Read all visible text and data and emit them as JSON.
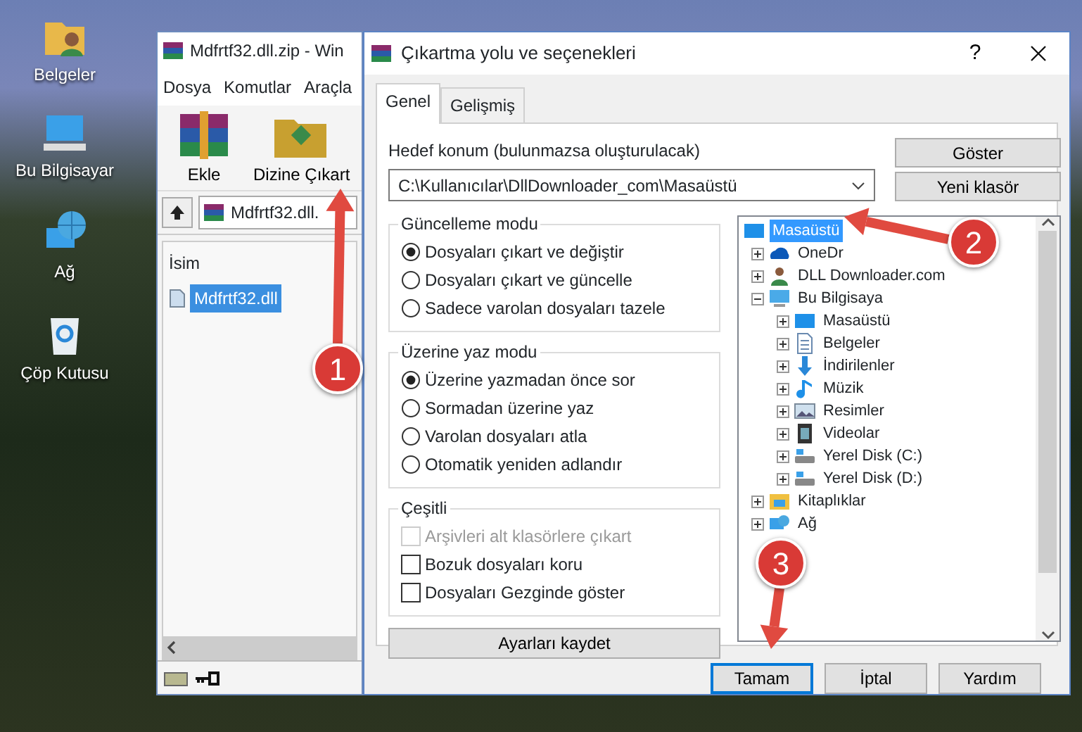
{
  "desktop_icons": [
    {
      "label": "Belgeler",
      "kind": "documents-folder"
    },
    {
      "label": "Bu Bilgisayar",
      "kind": "computer"
    },
    {
      "label": "Ağ",
      "kind": "network"
    },
    {
      "label": "Çöp Kutusu",
      "kind": "recycle-bin"
    }
  ],
  "winrar": {
    "title": "Mdfrtf32.dll.zip - Win",
    "menu": [
      "Dosya",
      "Komutlar",
      "Araçla"
    ],
    "toolbar": [
      {
        "label": "Ekle",
        "kind": "add"
      },
      {
        "label": "Dizine Çıkart",
        "kind": "extract"
      }
    ],
    "path": "Mdfrtf32.dll.",
    "column": "İsim",
    "files": [
      {
        "name": "Mdfrtf32.dll",
        "selected": true
      }
    ]
  },
  "dialog": {
    "title": "Çıkartma yolu ve seçenekleri",
    "help": "?",
    "tabs": [
      {
        "label": "Genel",
        "selected": true
      },
      {
        "label": "Gelişmiş",
        "selected": false
      }
    ],
    "destination_label": "Hedef konum (bulunmazsa oluşturulacak)",
    "destination": "C:\\Kullanıcılar\\DllDownloader_com\\Masaüstü",
    "side_buttons": [
      "Göster",
      "Yeni klasör"
    ],
    "update_mode": {
      "title": "Güncelleme modu",
      "options": [
        {
          "label": "Dosyaları çıkart ve değiştir",
          "selected": true
        },
        {
          "label": "Dosyaları çıkart ve güncelle",
          "selected": false
        },
        {
          "label": "Sadece varolan dosyaları tazele",
          "selected": false
        }
      ]
    },
    "overwrite_mode": {
      "title": "Üzerine yaz modu",
      "options": [
        {
          "label": "Üzerine yazmadan önce sor",
          "selected": true
        },
        {
          "label": "Sormadan üzerine yaz",
          "selected": false
        },
        {
          "label": "Varolan dosyaları atla",
          "selected": false
        },
        {
          "label": "Otomatik yeniden adlandır",
          "selected": false
        }
      ]
    },
    "misc": {
      "title": "Çeşitli",
      "options": [
        {
          "label": "Arşivleri alt klasörlere çıkart",
          "checked": false,
          "disabled": true
        },
        {
          "label": "Bozuk dosyaları koru",
          "checked": false,
          "disabled": false
        },
        {
          "label": "Dosyaları Gezginde göster",
          "checked": false,
          "disabled": false
        }
      ]
    },
    "save_button": "Ayarları kaydet",
    "tree": [
      {
        "label": "Masaüstü",
        "kind": "desktop",
        "selected": true,
        "children": [
          {
            "label": "OneDr",
            "kind": "cloud",
            "selected": false,
            "expanded": false
          },
          {
            "label": "DLL Downloader.com",
            "kind": "user",
            "selected": false,
            "expanded": false
          },
          {
            "label": "Bu Bilgisaya",
            "kind": "computer",
            "selected": false,
            "expanded": true,
            "children": [
              {
                "label": "Masaüstü",
                "kind": "desktop",
                "selected": false,
                "expanded": false
              },
              {
                "label": "Belgeler",
                "kind": "document",
                "selected": false,
                "expanded": false
              },
              {
                "label": "İndirilenler",
                "kind": "download",
                "selected": false,
                "expanded": false
              },
              {
                "label": "Müzik",
                "kind": "music",
                "selected": false,
                "expanded": false
              },
              {
                "label": "Resimler",
                "kind": "picture",
                "selected": false,
                "expanded": false
              },
              {
                "label": "Videolar",
                "kind": "video",
                "selected": false,
                "expanded": false
              },
              {
                "label": "Yerel Disk (C:)",
                "kind": "drive",
                "selected": false,
                "expanded": false
              },
              {
                "label": "Yerel Disk (D:)",
                "kind": "drive",
                "selected": false,
                "expanded": false
              }
            ]
          },
          {
            "label": "Kitaplıklar",
            "kind": "library",
            "selected": false,
            "expanded": false
          },
          {
            "label": "Ağ",
            "kind": "network",
            "selected": false,
            "expanded": false
          }
        ]
      }
    ],
    "buttons": [
      {
        "label": "Tamam",
        "focused": true
      },
      {
        "label": "İptal",
        "focused": false
      },
      {
        "label": "Yardım",
        "focused": false
      }
    ]
  },
  "annotations": [
    "1",
    "2",
    "3"
  ]
}
